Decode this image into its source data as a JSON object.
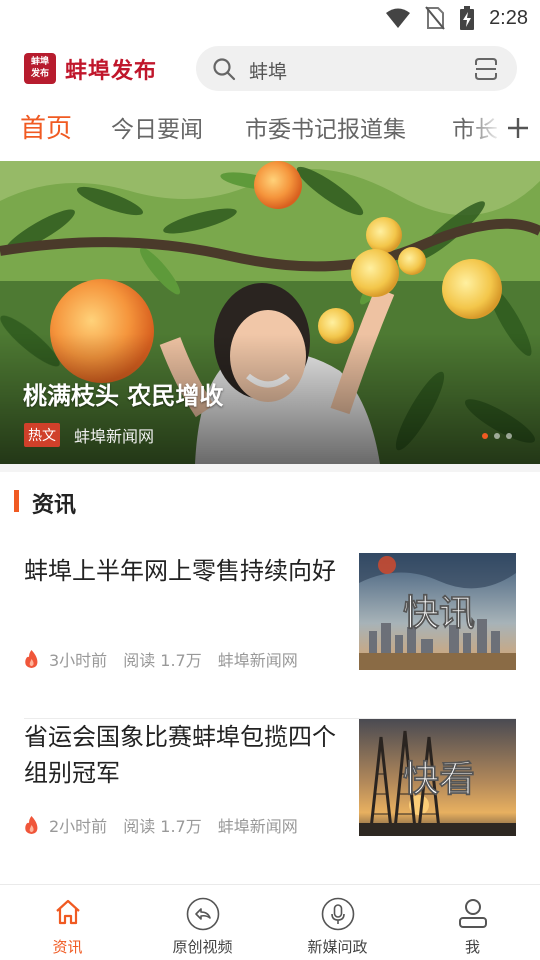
{
  "status_bar": {
    "time": "2:28",
    "icons": [
      "wifi-icon",
      "no-sim-icon",
      "battery-charging-icon"
    ]
  },
  "header": {
    "logo_badge": "蚌埠发布",
    "app_name": "蚌埠发布",
    "search_text": "蚌埠",
    "search_icon": "search-icon",
    "scan_icon": "scan-icon"
  },
  "tabs": [
    "首页",
    "今日要闻",
    "市委书记报道集",
    "市长"
  ],
  "tabs_add_icon": "plus-icon",
  "banner": {
    "title": "桃满枝头 农民增收",
    "tag": "热文",
    "source": "蚌埠新闻网",
    "slide_count": 3,
    "active_slide": 1
  },
  "section": {
    "title": "资讯"
  },
  "news": [
    {
      "title": "蚌埠上半年网上零售持续向好",
      "time": "3小时前",
      "reads": "阅读 1.7万",
      "source": "蚌埠新闻网",
      "thumb_text": "快讯"
    },
    {
      "title": "省运会国象比赛蚌埠包揽四个组别冠军",
      "time": "2小时前",
      "reads": "阅读 1.7万",
      "source": "蚌埠新闻网",
      "thumb_text": "快看"
    }
  ],
  "bottom_nav": [
    {
      "label": "资讯",
      "icon": "home-icon",
      "active": true
    },
    {
      "label": "原创视频",
      "icon": "video-icon",
      "active": false
    },
    {
      "label": "新媒问政",
      "icon": "microphone-icon",
      "active": false
    },
    {
      "label": "我",
      "icon": "user-icon",
      "active": false
    }
  ],
  "colors": {
    "accent": "#f05a22",
    "brand": "#c0162b",
    "tag": "#d0402a"
  }
}
